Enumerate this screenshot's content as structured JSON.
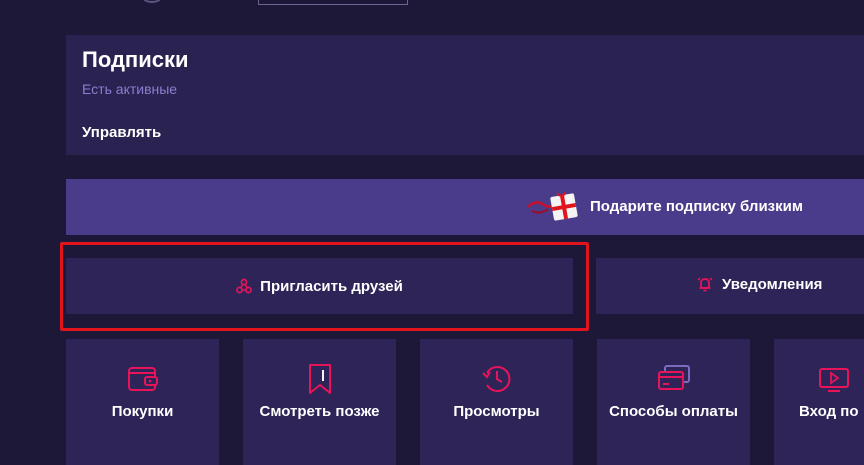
{
  "subscriptions": {
    "title": "Подписки",
    "status": "Есть активные",
    "manage_label": "Управлять"
  },
  "gift_banner": {
    "label": "Подарите подписку близким",
    "icon": "gift-icon"
  },
  "actions": {
    "invite": {
      "label": "Пригласить друзей",
      "icon": "share-icon"
    },
    "notifications": {
      "label": "Уведомления",
      "icon": "bell-icon"
    }
  },
  "tiles": [
    {
      "label": "Покупки",
      "icon": "wallet-icon"
    },
    {
      "label": "Смотреть позже",
      "icon": "bookmark-icon"
    },
    {
      "label": "Просмотры",
      "icon": "history-icon"
    },
    {
      "label": "Способы оплаты",
      "icon": "card-icon"
    },
    {
      "label": "Вход по",
      "icon": "tv-icon"
    }
  ],
  "colors": {
    "background": "#1e1838",
    "card": "#2a2250",
    "banner": "#4a3c8a",
    "accent": "#e8145a",
    "highlight": "#e0141c",
    "muted_text": "#8b7ed0"
  }
}
